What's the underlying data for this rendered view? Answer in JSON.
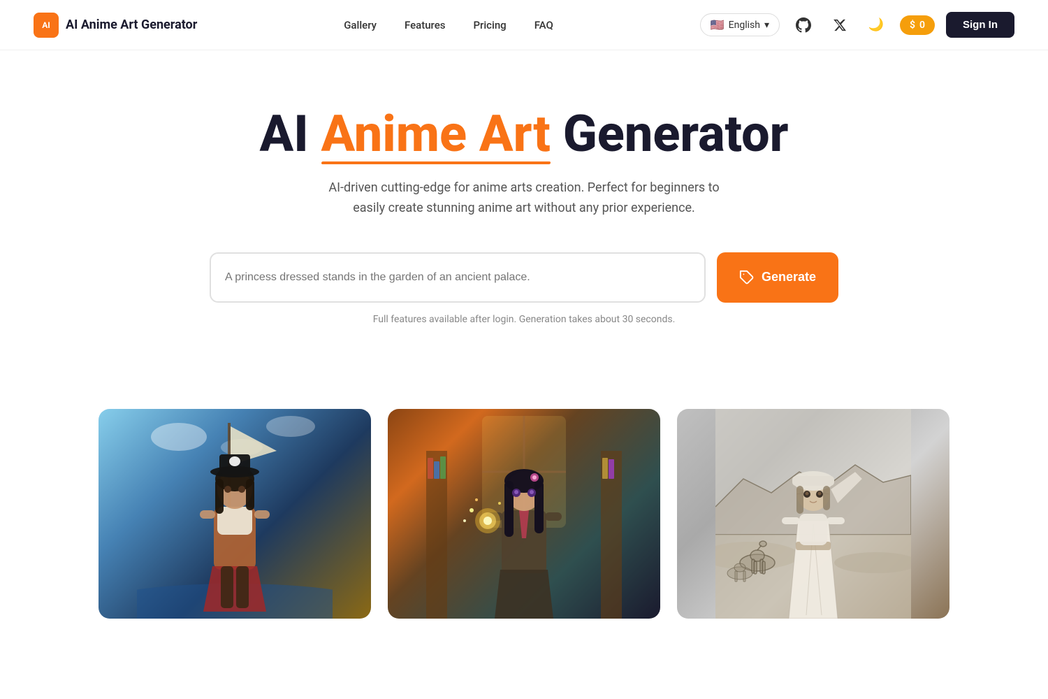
{
  "nav": {
    "logo_icon_text": "AI",
    "logo_text": "AI Anime Art Generator",
    "links": [
      {
        "label": "Gallery",
        "id": "gallery"
      },
      {
        "label": "Features",
        "id": "features"
      },
      {
        "label": "Pricing",
        "id": "pricing"
      },
      {
        "label": "FAQ",
        "id": "faq"
      }
    ],
    "language": {
      "flag": "🇺🇸",
      "label": "English",
      "chevron": "▾"
    },
    "credits": {
      "icon": "$",
      "count": "0"
    },
    "sign_in": "Sign In"
  },
  "hero": {
    "title": {
      "part1": "AI ",
      "part2": "Anime Art",
      "part3": " Generator"
    },
    "subtitle": "AI-driven cutting-edge for anime arts creation. Perfect for beginners to easily create stunning anime art without any prior experience.",
    "prompt_placeholder": "A princess dressed stands in the garden of an ancient palace.",
    "generate_label": "Generate",
    "login_note": "Full features available after login. Generation takes about 30 seconds."
  },
  "gallery": {
    "images": [
      {
        "alt": "Anime pirate girl on ship deck with ocean background",
        "theme": "pirate"
      },
      {
        "alt": "Anime girl with magic in a library setting",
        "theme": "magic"
      },
      {
        "alt": "Anime traveler in desert landscape with camels",
        "theme": "desert"
      }
    ]
  }
}
